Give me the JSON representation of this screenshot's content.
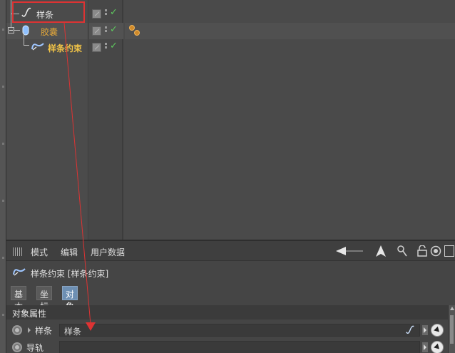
{
  "object_manager": {
    "objects": [
      {
        "name": "样条",
        "color": "plain"
      },
      {
        "name": "胶囊",
        "color": "orange"
      },
      {
        "name": "样条约束",
        "color": "yellow"
      }
    ]
  },
  "attributes": {
    "menu": [
      "模式",
      "编辑",
      "用户数据"
    ],
    "title": "样条约束 [样条约束]",
    "tabs": [
      "基本",
      "坐标",
      "对象"
    ],
    "active_tab": "对象",
    "section_title": "对象属性",
    "properties": [
      {
        "label": "样条",
        "value": "样条"
      },
      {
        "label": "导轨",
        "value": ""
      }
    ]
  },
  "colors": {
    "highlight": "#dd3333",
    "orange_text": "#e0a53a",
    "yellow_text": "#f2c447",
    "check_green": "#5ec95e",
    "active_tab": "#6d8fb3"
  },
  "icons": [
    "spline-icon",
    "capsule-icon",
    "spline-constraint-icon",
    "tag-material-icon",
    "back-arrow-icon",
    "cursor-icon",
    "search-icon",
    "lock-icon",
    "target-icon",
    "picker-icon"
  ]
}
